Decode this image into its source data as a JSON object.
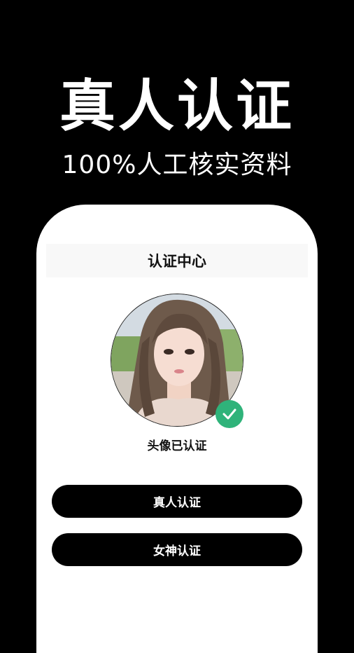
{
  "hero": {
    "title": "真人认证",
    "subtitle": "100%人工核实资料"
  },
  "card": {
    "title": "认证中心",
    "avatar_status": "头像已认证",
    "buttons": {
      "real_person": "真人认证",
      "goddess": "女神认证"
    }
  },
  "icons": {
    "verified": "check-circle-icon"
  },
  "colors": {
    "background": "#000000",
    "card": "#ffffff",
    "button": "#000000",
    "verified_badge": "#2fb37a"
  }
}
